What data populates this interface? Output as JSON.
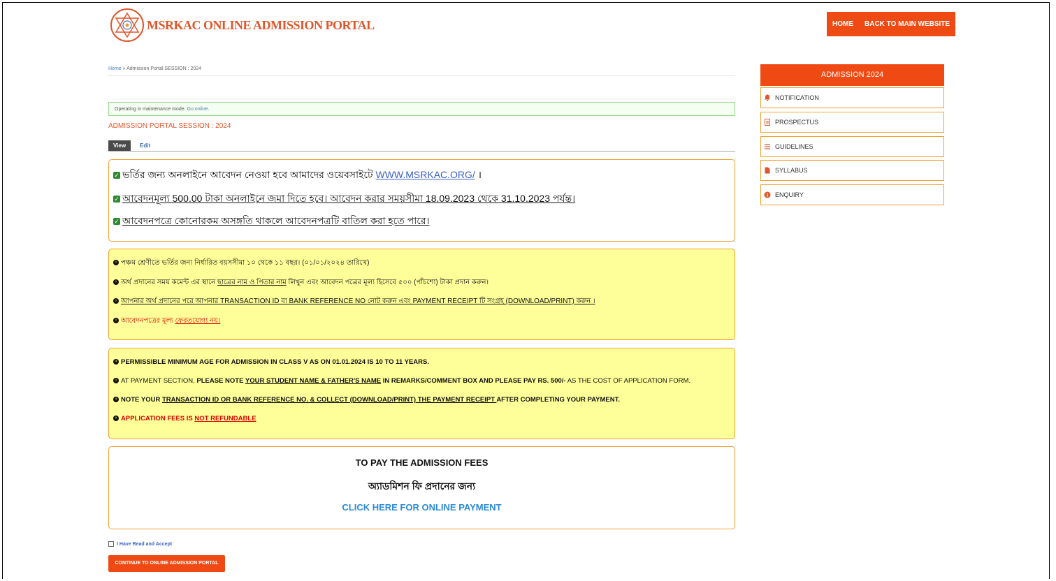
{
  "header": {
    "site_title": "MSRKAC ONLINE ADMISSION PORTAL",
    "nav": [
      "HOME",
      "BACK TO MAIN WEBSITE"
    ]
  },
  "breadcrumb": {
    "home": "Home",
    "sep": " » ",
    "current": "Admission Portal SESSION : 2024"
  },
  "maintenance": {
    "text": "Operating in maintenance mode. ",
    "link": "Go online."
  },
  "page_title": "ADMISSION PORTAL SESSION : 2024",
  "tabs": {
    "view": "View",
    "edit": "Edit"
  },
  "box1": {
    "l1_text": "ভর্তির জন্য অনলাইনে আবেদন নেওয়া হবে আমাদের ওয়েবসাইটে ",
    "l1_link": "WWW.MSRKAC.ORG/",
    "l1_end": " ।",
    "l2": "আবেদনমূল্য 500.00 টাকা অনলাইনে জমা দিতে হবে। আবেদন করার সময়সীমা 18.09.2023 থেকে 31.10.2023 পর্যন্ত।",
    "l3": "আবেদনপত্রে কোনোরকম অসঙ্গতি থাকলে আবেদনপত্রটি বাতিল করা হতে পারে।"
  },
  "box2": {
    "l1": "পঞ্চম শ্রেণীতে ভর্তির জন্য নির্ধারিত বয়সসীমা ১০ থেকে ১১ বছর। (০১/০১/২০২৪ তারিখে)",
    "l2_a": "অর্থ প্রদানের সময় কমেন্ট এর স্থানে ",
    "l2_b": "ছাত্রের নাম ও পিতার নাম",
    "l2_c": " লিখুন এবং আবেদন পত্রের মূল্য হিসেবে ৫০০ (পাঁচশো) টাকা প্রদান করুন।",
    "l3": "আপনার অর্থ প্রদানের পরে আপনার TRANSACTION ID বা BANK REFERENCE NO নোট করুন এবং PAYMENT RECEIPT টি সংগ্রহ (DOWNLOAD/PRINT) করুন ।",
    "l4_a": "আবেদনপত্রের মূল্য ",
    "l4_b": "ফেরতযোগ্য নয়।"
  },
  "box3": {
    "l1": "PERMISSIBLE MINIMUM AGE FOR ADMISSION IN CLASS V AS ON 01.01.2024 IS 10 TO 11 YEARS.",
    "l2_a": "AT PAYMENT SECTION, ",
    "l2_b": "PLEASE NOTE ",
    "l2_c": "YOUR STUDENT NAME & FATHER'S NAME",
    "l2_d": " IN REMARKS/COMMENT BOX AND PLEASE PAY RS. 500/-",
    "l2_e": " AS THE COST OF APPLICATION FORM.",
    "l3_a": "NOTE YOUR ",
    "l3_b": "TRANSACTION ID OR BANK REFERENCE NO. & COLLECT (DOWNLOAD/PRINT) THE PAYMENT RECEIPT ",
    "l3_c": " AFTER COMPLETING YOUR PAYMENT.",
    "l4_a": "APPLICATION FEES IS ",
    "l4_b": "NOT REFUNDABLE"
  },
  "box4": {
    "en": "TO PAY THE ADMISSION FEES",
    "bn": "অ্যাডমিশন ফি প্রদানের জন্য",
    "link": "CLICK HERE FOR ONLINE PAYMENT"
  },
  "accept_label": "I Have Read and Accept",
  "continue_button": "CONTINUE TO ONLINE ADMISSION PORTAL",
  "sidebar": {
    "title": "ADMISSION 2024",
    "items": [
      {
        "label": "NOTIFICATION",
        "icon": "bell-icon"
      },
      {
        "label": "PROSPECTUS",
        "icon": "document-icon"
      },
      {
        "label": "GUIDELINES",
        "icon": "list-icon"
      },
      {
        "label": "SYLLABUS",
        "icon": "file-icon"
      },
      {
        "label": "ENQUIRY",
        "icon": "info-icon"
      }
    ]
  },
  "colors": {
    "accent": "#f04a14",
    "box_border": "#f0a030",
    "notice_bg": "#ffff99"
  }
}
